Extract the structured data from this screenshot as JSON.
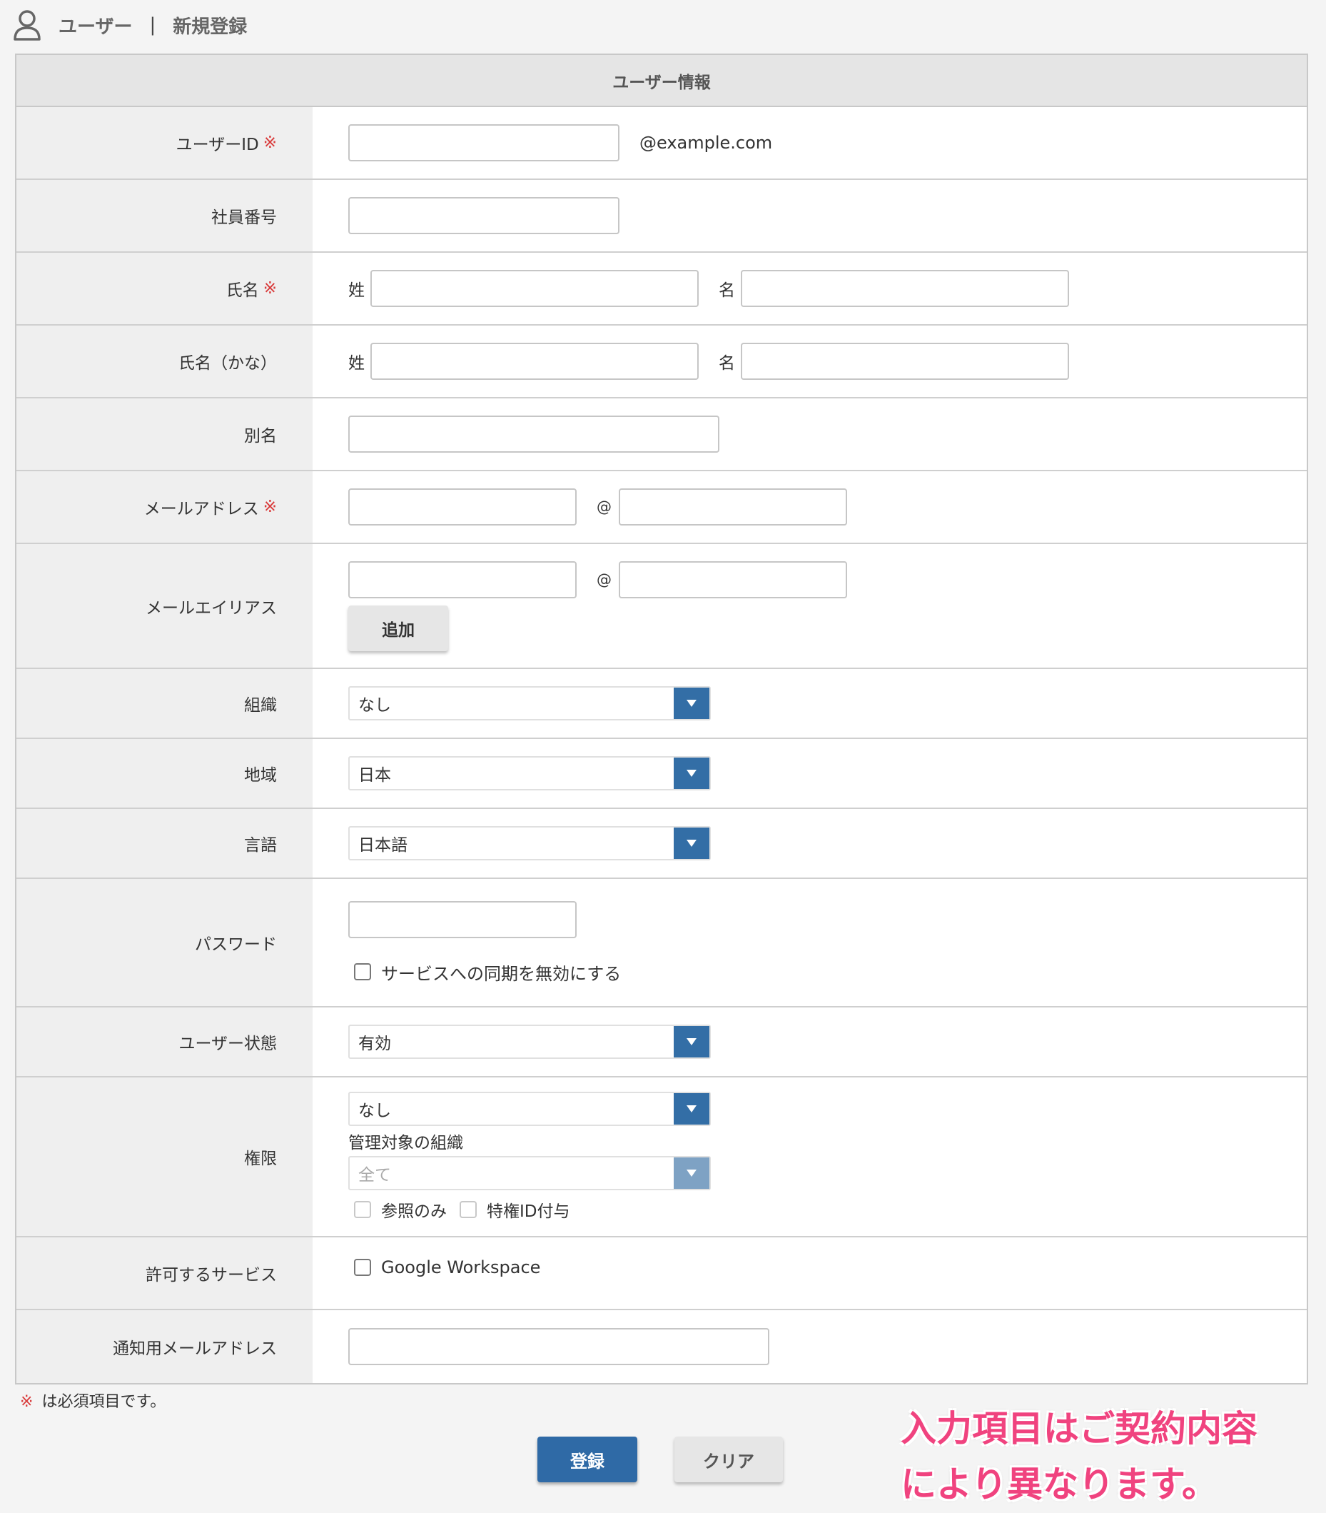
{
  "header": {
    "section": "ユーザー",
    "separator": "|",
    "page": "新規登録"
  },
  "form": {
    "section_title": "ユーザー情報",
    "required_mark": "※",
    "user_id": {
      "label": "ユーザーID",
      "value": "",
      "suffix": "@example.com"
    },
    "employee_number": {
      "label": "社員番号",
      "value": ""
    },
    "name": {
      "label": "氏名",
      "last_prefix": "姓",
      "last_value": "",
      "first_prefix": "名",
      "first_value": ""
    },
    "name_kana": {
      "label": "氏名（かな）",
      "last_prefix": "姓",
      "last_value": "",
      "first_prefix": "名",
      "first_value": ""
    },
    "alias_name": {
      "label": "別名",
      "value": ""
    },
    "email": {
      "label": "メールアドレス",
      "local_value": "",
      "at": "@",
      "domain_value": ""
    },
    "email_alias": {
      "label": "メールエイリアス",
      "local_value": "",
      "at": "@",
      "domain_value": "",
      "add_button": "追加"
    },
    "organization": {
      "label": "組織",
      "selected": "なし"
    },
    "region": {
      "label": "地域",
      "selected": "日本"
    },
    "language": {
      "label": "言語",
      "selected": "日本語"
    },
    "password": {
      "label": "パスワード",
      "value": "",
      "disable_sync_label": "サービスへの同期を無効にする"
    },
    "user_status": {
      "label": "ユーザー状態",
      "selected": "有効"
    },
    "permission": {
      "label": "権限",
      "selected": "なし",
      "managed_org_label": "管理対象の組織",
      "managed_org_selected": "全て",
      "read_only_label": "参照のみ",
      "privileged_id_label": "特権ID付与"
    },
    "allowed_services": {
      "label": "許可するサービス",
      "service_label": "Google Workspace"
    },
    "notification_email": {
      "label": "通知用メールアドレス",
      "value": ""
    }
  },
  "footer": {
    "required_note_mark": "※",
    "required_note": "は必須項目です。",
    "register_button": "登録",
    "clear_button": "クリア"
  },
  "callout": {
    "line1": "入力項目はご契約内容",
    "line2": "により異なります。"
  },
  "colors": {
    "accent": "#2f6aa6",
    "required": "#d93a3a",
    "callout": "#f0437f"
  },
  "icons": {
    "header": "user-icon",
    "select": "triangle-down-icon"
  }
}
